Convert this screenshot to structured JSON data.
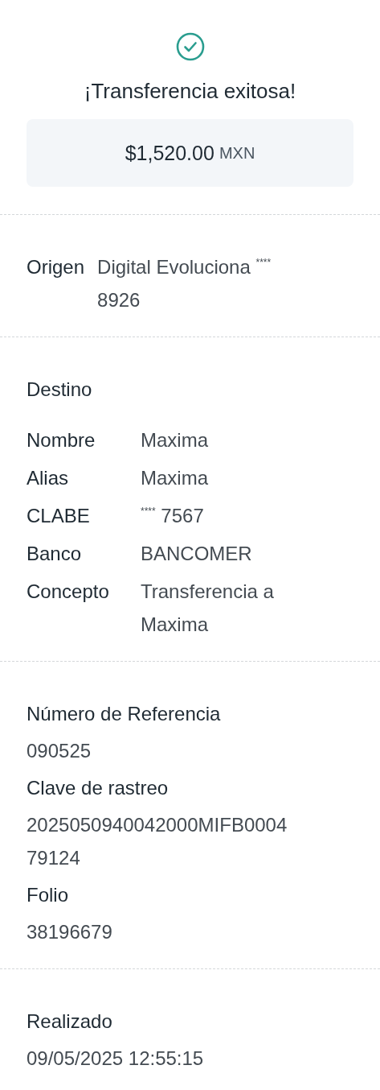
{
  "status": {
    "title": "¡Transferencia exitosa!",
    "amount": "$1,520.00",
    "currency": "MXN"
  },
  "origin": {
    "label": "Origen",
    "value": "Digital Evoluciona $^{****}$ 8926"
  },
  "destination": {
    "heading": "Destino",
    "fields": [
      {
        "label": "Nombre",
        "value": "Maxima"
      },
      {
        "label": "Alias",
        "value": "Maxima"
      },
      {
        "label": "CLABE",
        "value": "$^{****}$ 7567"
      },
      {
        "label": "Banco",
        "value": "BANCOMER"
      },
      {
        "label": "Concepto",
        "value": "Transferencia a Maxima"
      }
    ]
  },
  "reference": {
    "fields": [
      {
        "label": "Número de Referencia",
        "value": "090525"
      },
      {
        "label": "Clave de rastreo",
        "value": "2025050940042000MIFB000479124"
      },
      {
        "label": "Folio",
        "value": "38196679"
      }
    ]
  },
  "completed": {
    "label": "Realizado",
    "value": "09/05/2025 12:55:15"
  }
}
